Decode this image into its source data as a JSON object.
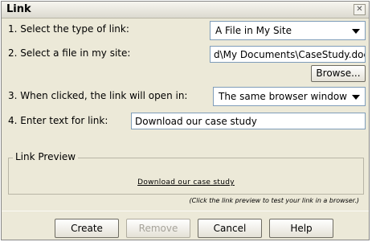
{
  "dialog": {
    "title": "Link"
  },
  "row1": {
    "label": "1. Select the type of link:",
    "selected": "A File in My Site"
  },
  "row2": {
    "label": "2. Select a file in my site:",
    "value": "d\\My Documents\\CaseStudy.doc",
    "browse_label": "Browse..."
  },
  "row3": {
    "label": "3. When clicked, the link will open in:",
    "selected": "The same browser window"
  },
  "row4": {
    "label": "4. Enter text for link:",
    "value": "Download our case study"
  },
  "preview": {
    "legend": "Link Preview",
    "link_text": "Download our case study",
    "note": "(Click the link preview to test your link in a browser.)"
  },
  "buttons": {
    "create": "Create",
    "remove": "Remove",
    "cancel": "Cancel",
    "help": "Help"
  }
}
